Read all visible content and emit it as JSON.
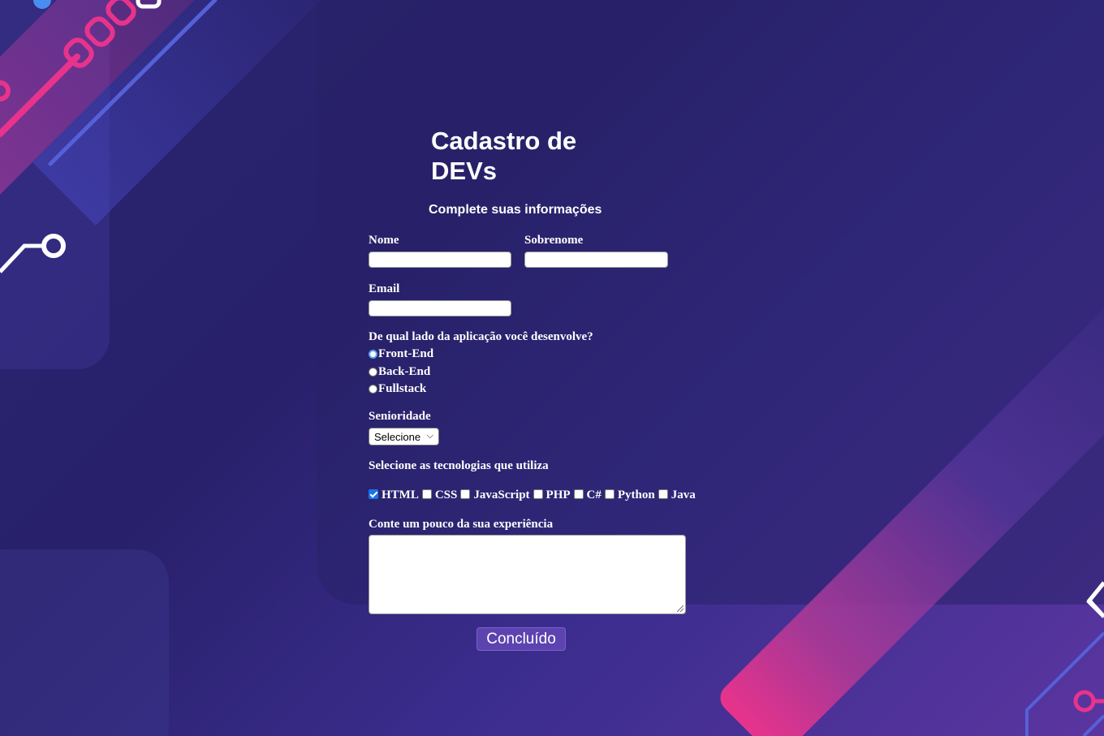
{
  "header": {
    "title": "Cadastro de DEVs",
    "subtitle": "Complete suas informações"
  },
  "form": {
    "nome_label": "Nome",
    "sobrenome_label": "Sobrenome",
    "email_label": "Email",
    "lado_question": "De qual lado da aplicação você desenvolve?",
    "lado_options": [
      {
        "label": "Front-End",
        "checked": true
      },
      {
        "label": "Back-End",
        "checked": false
      },
      {
        "label": "Fullstack",
        "checked": false
      }
    ],
    "senioridade_label": "Senioridade",
    "senioridade_selected": "Selecione",
    "tecnologias_label": "Selecione as tecnologias que utiliza",
    "tecnologias": [
      {
        "label": "HTML",
        "checked": true
      },
      {
        "label": "CSS",
        "checked": false
      },
      {
        "label": "JavaScript",
        "checked": false
      },
      {
        "label": "PHP",
        "checked": false
      },
      {
        "label": "C#",
        "checked": false
      },
      {
        "label": "Python",
        "checked": false
      },
      {
        "label": "Java",
        "checked": false
      }
    ],
    "experiencia_label": "Conte um pouco da sua experiência",
    "submit_label": "Concluído"
  },
  "colors": {
    "background": "#28206a",
    "accent_pink": "#e8338c",
    "button": "#5d43b0"
  }
}
